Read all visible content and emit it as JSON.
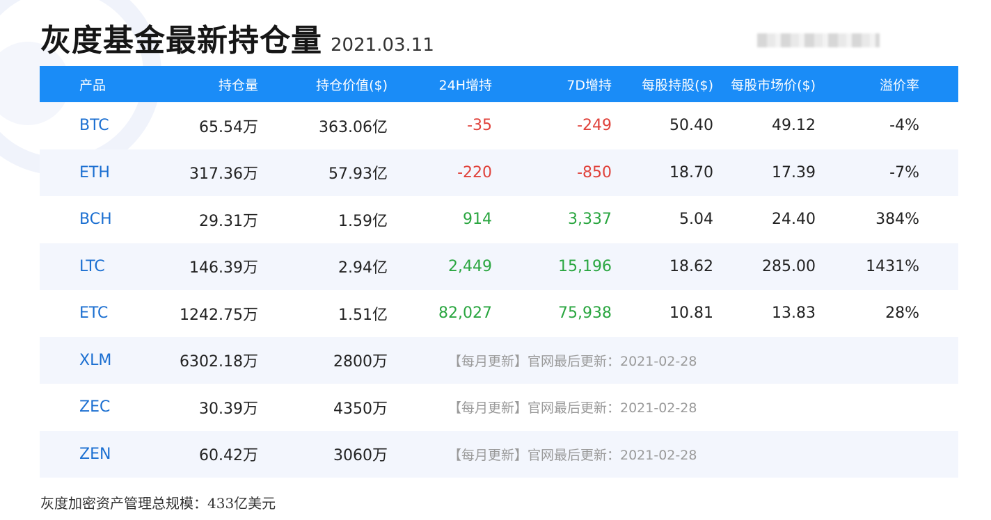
{
  "header": {
    "title": "灰度基金最新持仓量",
    "date": "2021.03.11"
  },
  "colors": {
    "header_bg": "#1a8cf7",
    "product": "#1b6fd1",
    "negative": "#e0413a",
    "positive": "#2aa640",
    "note": "#9a9a9a",
    "alt_row": "#f3f6fd"
  },
  "table": {
    "columns": [
      "产品",
      "持仓量",
      "持仓价值($)",
      "24H增持",
      "7D增持",
      "每股持股($)",
      "每股市场价($)",
      "溢价率"
    ],
    "rows": [
      {
        "product": "BTC",
        "holdings": "65.54万",
        "value": "363.06亿",
        "h24": "-35",
        "d7": "-249",
        "per_share": "50.40",
        "market_price": "49.12",
        "premium": "-4%"
      },
      {
        "product": "ETH",
        "holdings": "317.36万",
        "value": "57.93亿",
        "h24": "-220",
        "d7": "-850",
        "per_share": "18.70",
        "market_price": "17.39",
        "premium": "-7%"
      },
      {
        "product": "BCH",
        "holdings": "29.31万",
        "value": "1.59亿",
        "h24": "914",
        "d7": "3,337",
        "per_share": "5.04",
        "market_price": "24.40",
        "premium": "384%"
      },
      {
        "product": "LTC",
        "holdings": "146.39万",
        "value": "2.94亿",
        "h24": "2,449",
        "d7": "15,196",
        "per_share": "18.62",
        "market_price": "285.00",
        "premium": "1431%"
      },
      {
        "product": "ETC",
        "holdings": "1242.75万",
        "value": "1.51亿",
        "h24": "82,027",
        "d7": "75,938",
        "per_share": "10.81",
        "market_price": "13.83",
        "premium": "28%"
      },
      {
        "product": "XLM",
        "holdings": "6302.18万",
        "value": "2800万",
        "note": "【每月更新】官网最后更新：2021-02-28"
      },
      {
        "product": "ZEC",
        "holdings": "30.39万",
        "value": "4350万",
        "note": "【每月更新】官网最后更新：2021-02-28"
      },
      {
        "product": "ZEN",
        "holdings": "60.42万",
        "value": "3060万",
        "note": "【每月更新】官网最后更新：2021-02-28"
      }
    ]
  },
  "footer": {
    "text": "灰度加密资产管理总规模：433亿美元"
  }
}
